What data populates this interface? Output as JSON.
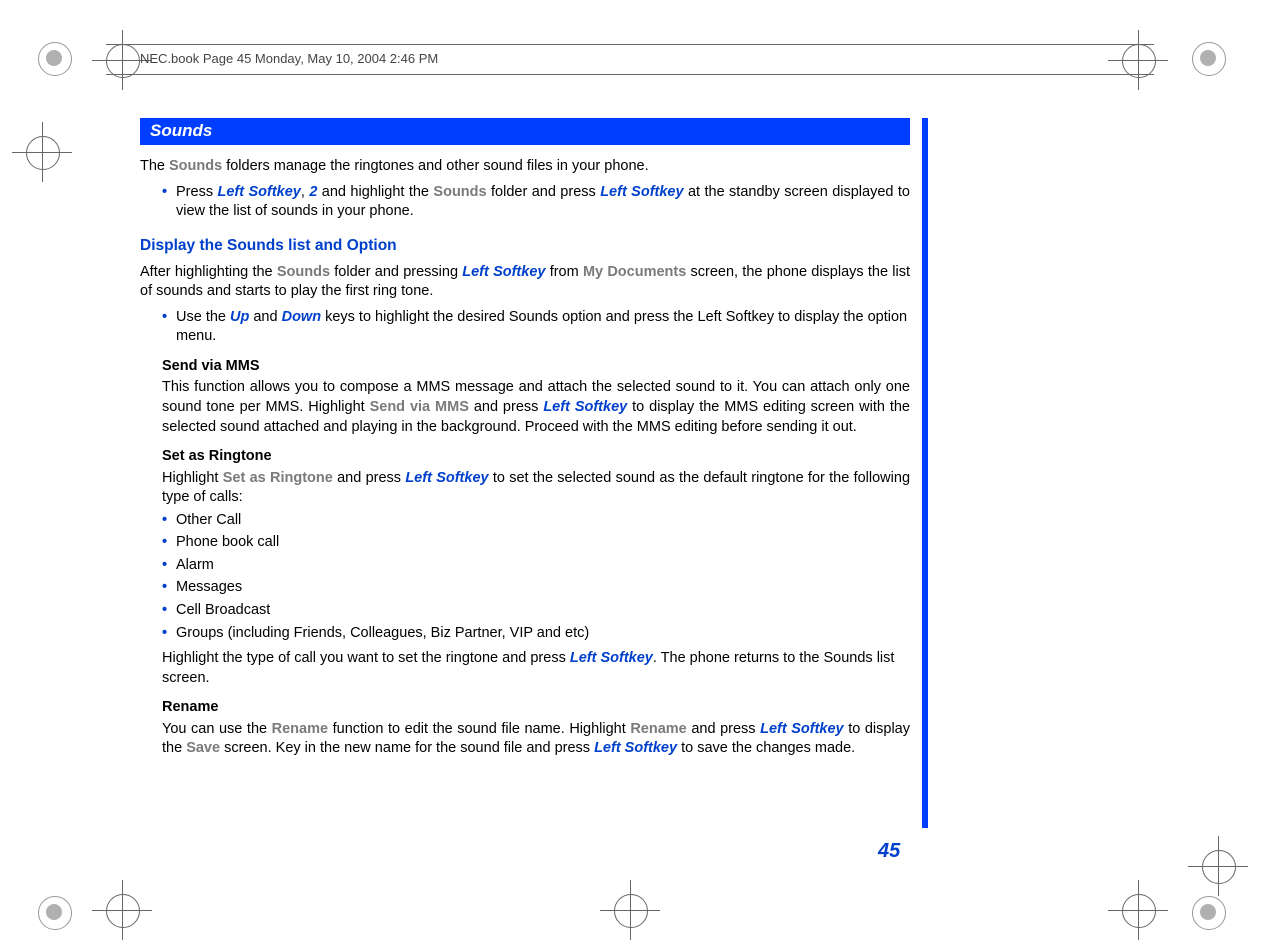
{
  "header": {
    "text": "NEC.book  Page 45  Monday, May 10, 2004  2:46 PM"
  },
  "page_number": "45",
  "section": {
    "title": "Sounds",
    "intro_pre": "The ",
    "intro_bold": "Sounds",
    "intro_post": " folders manage the ringtones and other sound files in your phone.",
    "bullet1_press": "Press ",
    "bullet1_ls": "Left Softkey",
    "bullet1_comma": ", ",
    "bullet1_two": "2",
    "bullet1_mid": " and highlight the ",
    "bullet1_sounds": "Sounds",
    "bullet1_mid2": " folder and press ",
    "bullet1_ls2": "Left Softkey",
    "bullet1_end": " at the standby screen displayed to view the list of sounds in your phone."
  },
  "display_section": {
    "heading": "Display the Sounds list and Option",
    "p1_pre": "After highlighting the ",
    "p1_sounds": "Sounds",
    "p1_mid": " folder and pressing ",
    "p1_ls": "Left Softkey",
    "p1_from": " from ",
    "p1_mydoc": "My Documents",
    "p1_end": " screen, the phone displays the list of sounds and starts to play the first ring tone.",
    "bullet_use_pre": "Use the ",
    "bullet_up": "Up",
    "bullet_and": " and ",
    "bullet_down": "Down",
    "bullet_use_post": " keys to highlight the desired Sounds option and press the Left Softkey to display the option menu."
  },
  "send_mms": {
    "title": "Send via MMS",
    "p_pre": "This function allows you to compose a MMS message and attach the selected sound to it. You can attach only one sound tone per MMS. Highlight ",
    "p_bold": "Send via MMS",
    "p_mid": " and press ",
    "p_ls": "Left Softkey",
    "p_end": " to display the MMS editing screen with the selected sound attached and playing in the background. Proceed with the MMS editing before sending it out."
  },
  "set_ringtone": {
    "title": "Set as Ringtone",
    "p_pre": "Highlight ",
    "p_bold": "Set as Ringtone",
    "p_mid": " and press ",
    "p_ls": "Left Softkey",
    "p_end": " to set the selected sound as the default ringtone for the following type of calls:",
    "items": {
      "0": "Other Call",
      "1": "Phone book call",
      "2": "Alarm",
      "3": "Messages",
      "4": "Cell Broadcast",
      "5": "Groups (including Friends, Colleagues, Biz Partner, VIP and etc)"
    },
    "closing_pre": "Highlight the type of call you want to set the ringtone and press ",
    "closing_ls": "Left Softkey",
    "closing_post": ". The phone returns to the Sounds list screen."
  },
  "rename": {
    "title": "Rename",
    "p_pre": "You can use the ",
    "p_bold1": "Rename",
    "p_mid1": " function to edit the sound file name. Highlight ",
    "p_bold2": "Rename",
    "p_mid2": " and press ",
    "p_ls1": "Left Softkey",
    "p_mid3": " to display the ",
    "p_save": "Save",
    "p_mid4": " screen. Key in the new name for the sound file and press ",
    "p_ls2": "Left Softkey",
    "p_end": " to save the changes made."
  },
  "bullet_glyph": "•"
}
